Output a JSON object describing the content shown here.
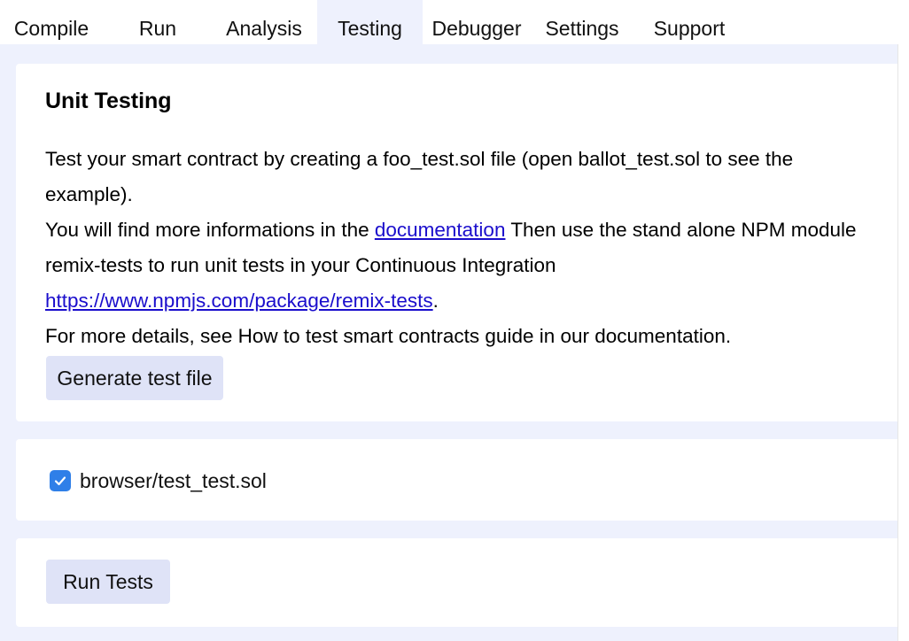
{
  "tabs": [
    {
      "label": "Compile"
    },
    {
      "label": "Run"
    },
    {
      "label": "Analysis"
    },
    {
      "label": "Testing",
      "active": true
    },
    {
      "label": "Debugger"
    },
    {
      "label": "Settings"
    },
    {
      "label": "Support"
    }
  ],
  "unit_testing": {
    "heading": "Unit Testing",
    "line1": "Test your smart contract by creating a foo_test.sol file (open ballot_test.sol to see the example).",
    "line2_prefix": "You will find more informations in the ",
    "line2_link": "documentation",
    "line2_suffix": " Then use the stand alone NPM module remix-tests to run unit tests in your Continuous Integration ",
    "npm_link": "https://www.npmjs.com/package/remix-tests",
    "npm_suffix": ".",
    "line3": "For more details, see How to test smart contracts guide in our documentation.",
    "generate_button": "Generate test file"
  },
  "test_files": [
    {
      "path": "browser/test_test.sol",
      "checked": true
    }
  ],
  "run_button": "Run Tests",
  "colors": {
    "accent": "#2f7fe8",
    "panel_background": "#eef1fd",
    "button_background": "#dfe3f7",
    "link": "#1a0dcc"
  },
  "icons": {
    "checkbox": "checkmark-icon"
  }
}
